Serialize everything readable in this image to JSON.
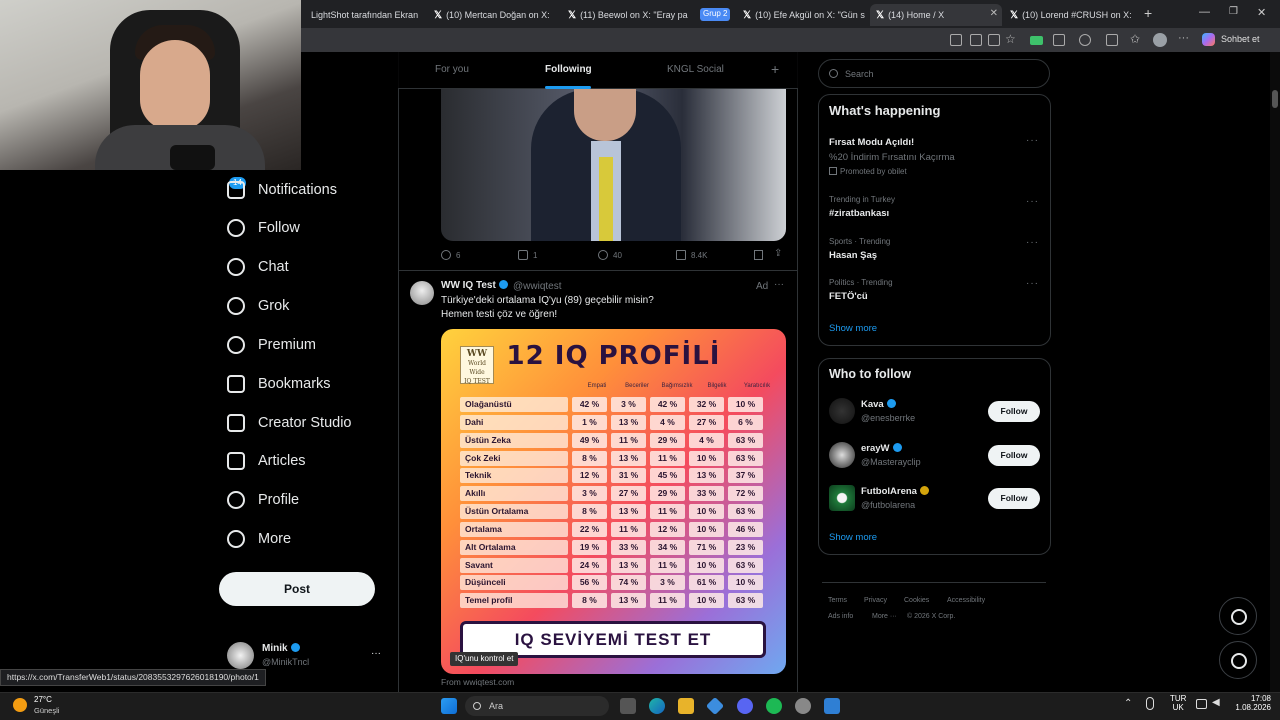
{
  "browser": {
    "tabs": [
      {
        "title": "LightShot tarafından Ekran",
        "x": false
      },
      {
        "title": "(10) Mertcan Doğan on X:",
        "x": true
      },
      {
        "title": "(11) Beewol on X: \"Eray pa",
        "x": true
      },
      {
        "group": "Grup 2"
      },
      {
        "title": "(10) Efe Akgül on X: \"Gün s",
        "x": true
      },
      {
        "title": "(14) Home / X",
        "x": true
      },
      {
        "title": "(10) Lorend #CRUSH on X:",
        "x": true
      }
    ],
    "profile_button": "Sohbet et"
  },
  "sidebar": {
    "notification_badge": "14",
    "items": [
      {
        "label": "Notifications",
        "icon": "bell-icon"
      },
      {
        "label": "Follow",
        "icon": "person-plus-icon"
      },
      {
        "label": "Chat",
        "icon": "chat-icon"
      },
      {
        "label": "Grok",
        "icon": "grok-icon"
      },
      {
        "label": "Premium",
        "icon": "verified-icon"
      },
      {
        "label": "Bookmarks",
        "icon": "bookmark-icon"
      },
      {
        "label": "Creator Studio",
        "icon": "rocket-icon"
      },
      {
        "label": "Articles",
        "icon": "article-icon"
      },
      {
        "label": "Profile",
        "icon": "user-icon"
      },
      {
        "label": "More",
        "icon": "more-circle-icon"
      }
    ],
    "post_button": "Post",
    "account": {
      "name": "Minik",
      "handle": "@MinikTncl"
    }
  },
  "feed": {
    "tabs": [
      "For you",
      "Following",
      "KNGL Social"
    ],
    "active_tab": "Following",
    "post1_stats": {
      "replies": "6",
      "reposts": "1",
      "likes": "40",
      "views": "8.4K"
    },
    "ad_post": {
      "author": "WW IQ Test",
      "handle": "@wwiqtest",
      "ad_label": "Ad",
      "text_line1": "Türkiye'deki ortalama IQ'yu (89) geçebilir misin?",
      "text_line2": "Hemen testi çöz ve öğren!",
      "image": {
        "logo_line1": "WW",
        "logo_line2": "World Wide",
        "logo_line3": "IQ TEST",
        "title": "12 IQ PROFİLİ",
        "columns": [
          "Empati",
          "Beceriler",
          "Bağımsızlık",
          "Bilgelik",
          "Yaratıcılık"
        ],
        "rows": [
          {
            "name": "Olağanüstü",
            "values": [
              "42 %",
              "3 %",
              "42 %",
              "32 %",
              "10 %"
            ]
          },
          {
            "name": "Dahi",
            "values": [
              "1 %",
              "13 %",
              "4 %",
              "27 %",
              "6 %"
            ]
          },
          {
            "name": "Üstün Zeka",
            "values": [
              "49 %",
              "11 %",
              "29 %",
              "4 %",
              "63 %"
            ]
          },
          {
            "name": "Çok Zeki",
            "values": [
              "8 %",
              "13 %",
              "11 %",
              "10 %",
              "63 %"
            ]
          },
          {
            "name": "Teknik",
            "values": [
              "12 %",
              "31 %",
              "45 %",
              "13 %",
              "37 %"
            ]
          },
          {
            "name": "Akıllı",
            "values": [
              "3 %",
              "27 %",
              "29 %",
              "33 %",
              "72 %"
            ]
          },
          {
            "name": "Üstün Ortalama",
            "values": [
              "8 %",
              "13 %",
              "11 %",
              "10 %",
              "63 %"
            ]
          },
          {
            "name": "Ortalama",
            "values": [
              "22 %",
              "11 %",
              "12 %",
              "10 %",
              "46 %"
            ]
          },
          {
            "name": "Alt Ortalama",
            "values": [
              "19 %",
              "33 %",
              "34 %",
              "71 %",
              "23 %"
            ]
          },
          {
            "name": "Savant",
            "values": [
              "24 %",
              "13 %",
              "11 %",
              "10 %",
              "63 %"
            ]
          },
          {
            "name": "Düşünceli",
            "values": [
              "56 %",
              "74 %",
              "3 %",
              "61 %",
              "10 %"
            ]
          },
          {
            "name": "Temel profil",
            "values": [
              "8 %",
              "13 %",
              "11 %",
              "10 %",
              "63 %"
            ]
          }
        ],
        "cta": "IQ SEVİYEMİ TEST ET"
      },
      "tooltip": "IQ'unu kontrol et",
      "source": "From wwiqtest.com"
    }
  },
  "right": {
    "search_placeholder": "Search",
    "whats_happening": {
      "title": "What's happening",
      "promo_title": "Fırsat Modu Açıldı!",
      "promo_sub": "%20 İndirim Fırsatını Kaçırma",
      "promo_by": "Promoted by obilet",
      "trends": [
        {
          "context": "Trending in Turkey",
          "name": "#ziratbankası"
        },
        {
          "context": "Sports · Trending",
          "name": "Hasan Şaş"
        },
        {
          "context": "Politics · Trending",
          "name": "FETÖ'cü"
        }
      ],
      "show_more": "Show more"
    },
    "who_to_follow": {
      "title": "Who to follow",
      "accounts": [
        {
          "name": "Kava",
          "handle": "@enesberrke",
          "button": "Follow"
        },
        {
          "name": "erayW",
          "handle": "@Masterayclip",
          "button": "Follow"
        },
        {
          "name": "FutbolArena",
          "handle": "@futbolarena",
          "button": "Follow"
        }
      ],
      "show_more": "Show more"
    },
    "footer": [
      "Terms",
      "Privacy",
      "Cookies",
      "Accessibility",
      "Ads info",
      "More ···",
      "© 2026 X Corp."
    ]
  },
  "status_url": "https://x.com/TransferWeb1/status/2083553297626018190/photo/1",
  "taskbar": {
    "temp": "27°C",
    "weather": "Güneşli",
    "search": "Ara",
    "lang1": "TUR",
    "lang2": "UK",
    "time": "17:08",
    "date": "1.08.2026"
  }
}
